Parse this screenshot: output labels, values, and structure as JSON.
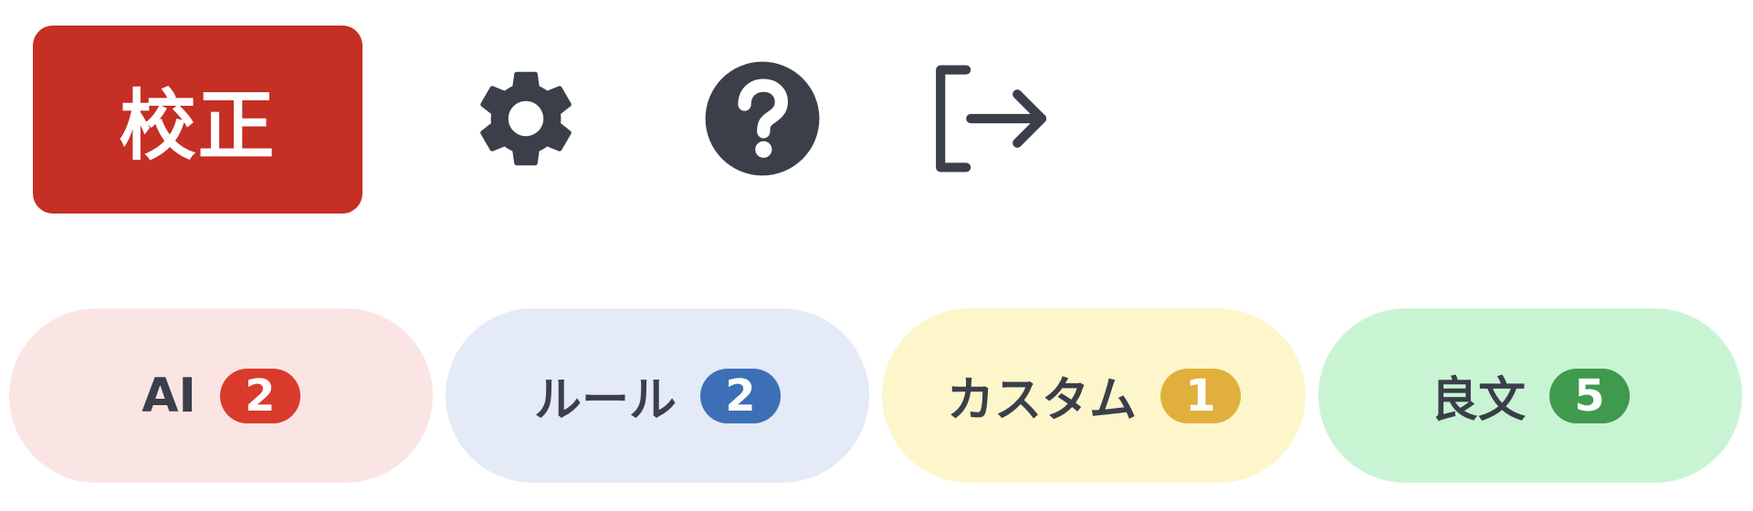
{
  "toolbar": {
    "proofread_label": "校正",
    "proofread_color": "#c52f24",
    "icons": [
      "gear-icon",
      "help-circle-icon",
      "logout-icon"
    ],
    "icon_color": "#3a3f49"
  },
  "tabs": [
    {
      "label": "AI",
      "count": "2",
      "background": "#fbe5e4",
      "badge_color": "#d93a2b"
    },
    {
      "label": "ルール",
      "count": "2",
      "background": "#e4eaf6",
      "badge_color": "#3d6fb6"
    },
    {
      "label": "カスタム",
      "count": "1",
      "background": "#fdf6cb",
      "badge_color": "#e1af3c"
    },
    {
      "label": "良文",
      "count": "5",
      "background": "#c9f4d4",
      "badge_color": "#3f9a4e"
    }
  ]
}
